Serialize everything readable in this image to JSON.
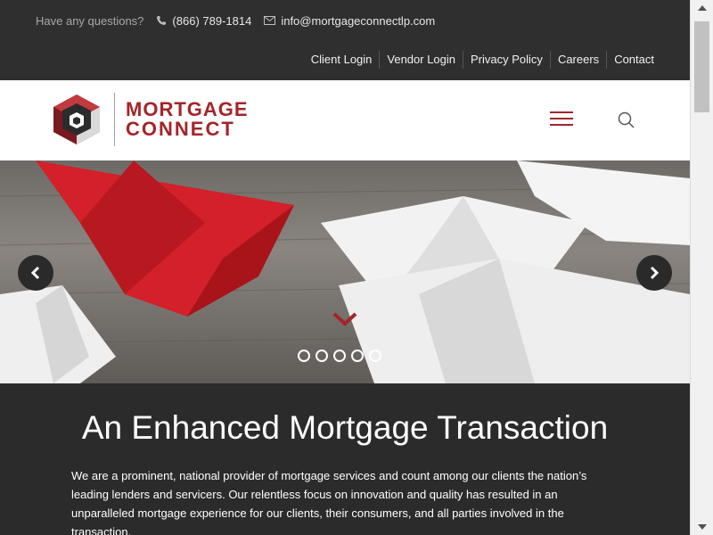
{
  "topbar": {
    "question": "Have any questions?",
    "phone": "(866) 789-1814",
    "email": "info@mortgageconnectlp.com",
    "links": [
      "Client Login",
      "Vendor Login",
      "Privacy Policy",
      "Careers",
      "Contact"
    ]
  },
  "header": {
    "logo_line1": "MORTGAGE",
    "logo_line2": "CONNECT",
    "menu_icon": "hamburger-icon",
    "search_icon": "search-icon",
    "brand_color": "#a5242a"
  },
  "hero": {
    "slide_count": 5,
    "prev_icon": "chevron-left-icon",
    "next_icon": "chevron-right-icon",
    "scroll_down_icon": "chevron-down-icon"
  },
  "content": {
    "heading": "An Enhanced Mortgage Transaction",
    "body": "We are a prominent, national provider of mortgage services and count among our clients the nation’s leading lenders and servicers. Our relentless focus on innovation and quality has resulted in an unparalleled mortgage experience for our clients, their consumers, and all parties involved in the transaction."
  },
  "colors": {
    "dark_bg": "#2b2b2b",
    "accent": "#a5242a"
  }
}
